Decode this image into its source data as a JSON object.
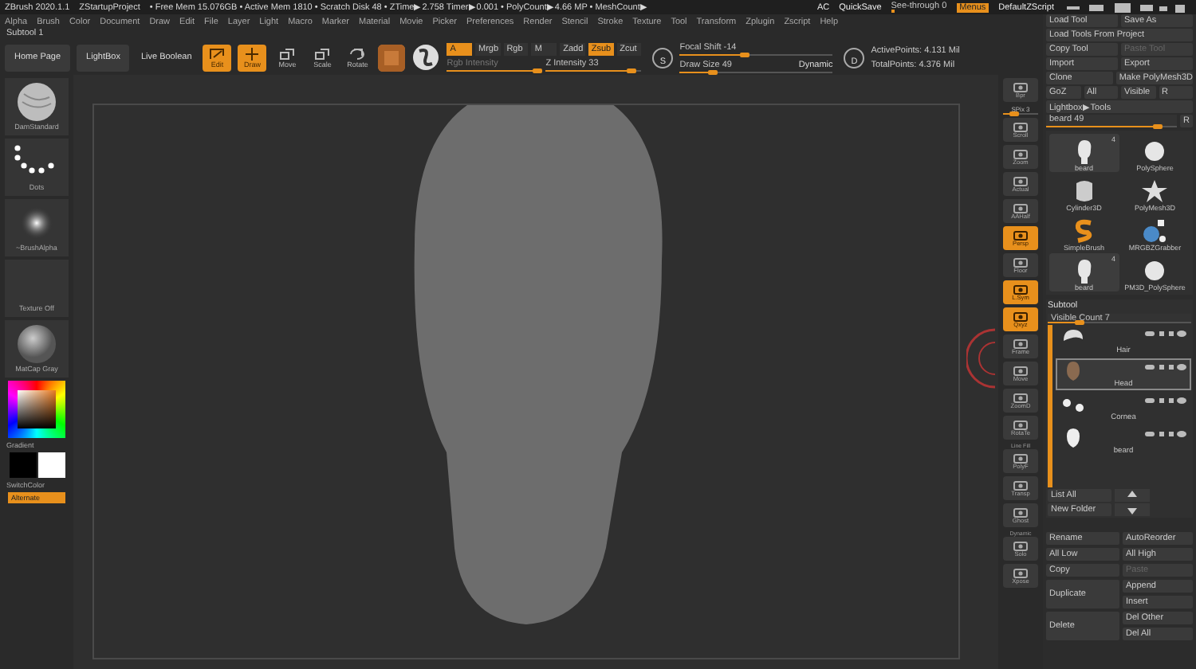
{
  "title_bar": {
    "app": "ZBrush 2020.1.1",
    "project": "ZStartupProject",
    "stats": "• Free Mem 15.076GB • Active Mem 1810 • Scratch Disk 48 • ZTime▶2.758 Timer▶0.001 • PolyCount▶4.66 MP • MeshCount▶",
    "controls": [
      {
        "kind": "text",
        "label": "AC"
      },
      {
        "kind": "text",
        "label": "QuickSave"
      },
      {
        "kind": "slider",
        "label": "See-through  0",
        "level": 0.05
      },
      {
        "kind": "toggle",
        "label": "Menus",
        "on": true
      },
      {
        "kind": "text",
        "label": "DefaultZScript"
      }
    ]
  },
  "menu_bar": [
    "Alpha",
    "Brush",
    "Color",
    "Document",
    "Draw",
    "Edit",
    "File",
    "Layer",
    "Light",
    "Macro",
    "Marker",
    "Material",
    "Movie",
    "Picker",
    "Preferences",
    "Render",
    "Stencil",
    "Stroke",
    "Texture",
    "Tool",
    "Transform",
    "Zplugin",
    "Zscript",
    "Help"
  ],
  "subtool_label": "Subtool 1",
  "toolbar": {
    "buttons": [
      {
        "kind": "plain",
        "label": "Home Page",
        "on": false
      },
      {
        "kind": "plain",
        "label": "LightBox",
        "on": false
      },
      {
        "kind": "text",
        "label": "Live Boolean",
        "on": false
      },
      {
        "kind": "edit",
        "label": "Edit",
        "on": true
      },
      {
        "kind": "draw",
        "label": "Draw",
        "on": true
      },
      {
        "kind": "move",
        "label": "Move",
        "on": false
      },
      {
        "kind": "scale",
        "label": "Scale",
        "on": false
      },
      {
        "kind": "rotate",
        "label": "Rotate",
        "on": false
      }
    ],
    "modes": [
      {
        "label": "A",
        "on": true
      },
      {
        "label": "Mrgb",
        "on": false
      },
      {
        "label": "Rgb",
        "on": false
      },
      {
        "label": "M",
        "on": false
      },
      {
        "label": "Zadd",
        "on": false
      },
      {
        "label": "Zsub",
        "on": true
      },
      {
        "label": "Zcut",
        "on": false
      }
    ],
    "rgb_intensity": {
      "label": "Rgb Intensity",
      "level": 0.95
    },
    "z_intensity": {
      "label": "Z Intensity 33",
      "level": 0.9
    },
    "focal_icon": "S",
    "focal_shift": {
      "label": "Focal Shift -14",
      "level": 0.42
    },
    "draw_size": {
      "label": "Draw Size 49",
      "level": 0.22,
      "badge": "Dynamic"
    },
    "points_icon": "D",
    "points": [
      "ActivePoints: 4.131 Mil",
      "TotalPoints: 4.376 Mil"
    ]
  },
  "left_shelf": {
    "items": [
      {
        "kind": "brush",
        "label": "DamStandard"
      },
      {
        "kind": "stroke",
        "label": "Dots"
      },
      {
        "kind": "alpha",
        "label": "~BrushAlpha"
      },
      {
        "kind": "texture",
        "label": "Texture Off"
      },
      {
        "kind": "material",
        "label": "MatCap Gray"
      }
    ],
    "gradient_label": "Gradient",
    "switch_label": "SwitchColor",
    "alternate": {
      "label": "Alternate",
      "on": true
    }
  },
  "right_shelf": [
    {
      "kind": "button",
      "label": "Bpr",
      "on": false
    },
    {
      "kind": "slider",
      "label": "SPix 3",
      "level": 0.3
    },
    {
      "kind": "button",
      "label": "Scroll",
      "on": false
    },
    {
      "kind": "button",
      "label": "Zoom",
      "on": false
    },
    {
      "kind": "button",
      "label": "Actual",
      "on": false
    },
    {
      "kind": "button",
      "label": "AAHalf",
      "on": false
    },
    {
      "kind": "button",
      "label": "Persp",
      "on": true
    },
    {
      "kind": "button",
      "label": "Floor",
      "on": false
    },
    {
      "kind": "button",
      "label": "L.Sym",
      "on": true
    },
    {
      "kind": "button",
      "label": "Qxyz",
      "on": true
    },
    {
      "kind": "button",
      "label": "Frame",
      "on": false
    },
    {
      "kind": "button",
      "label": "Move",
      "on": false
    },
    {
      "kind": "button",
      "label": "ZoomD",
      "on": false
    },
    {
      "kind": "button",
      "label": "RotaTe",
      "on": false
    },
    {
      "kind": "button",
      "label": "PolyF",
      "caption": "Line Fill",
      "on": false
    },
    {
      "kind": "button",
      "label": "Transp",
      "on": false
    },
    {
      "kind": "button",
      "label": "Ghost",
      "on": false
    },
    {
      "kind": "button",
      "label": "Solo",
      "caption": "Dynamic",
      "on": false
    },
    {
      "kind": "button",
      "label": "Xpose",
      "on": false
    }
  ],
  "tool_panel": {
    "rows": [
      [
        {
          "label": "Load Tool",
          "disabled": false
        },
        {
          "label": "Save As",
          "disabled": false
        }
      ],
      [
        {
          "label": "Load Tools From Project",
          "disabled": false
        }
      ],
      [
        {
          "label": "Copy Tool",
          "disabled": false
        },
        {
          "label": "Paste Tool",
          "disabled": true
        }
      ],
      [
        {
          "label": "Import",
          "disabled": false
        },
        {
          "label": "Export",
          "disabled": false
        }
      ],
      [
        {
          "label": "Clone",
          "disabled": false
        },
        {
          "label": "Make PolyMesh3D",
          "disabled": false
        }
      ],
      [
        {
          "label": "GoZ",
          "disabled": false
        },
        {
          "label": "All",
          "disabled": false
        },
        {
          "label": "Visible",
          "disabled": false
        },
        {
          "label": "R",
          "disabled": false
        }
      ],
      [
        {
          "label": "Lightbox▶Tools",
          "disabled": false
        }
      ]
    ],
    "slider": {
      "label": "beard  49",
      "level": 0.85,
      "reset": "R"
    },
    "tools": [
      {
        "kind": "head",
        "name": "beard",
        "count": "4"
      },
      {
        "kind": "sphere",
        "name": "PolySphere"
      },
      {
        "kind": "cylinder",
        "name": "Cylinder3D"
      },
      {
        "kind": "star",
        "name": "PolyMesh3D"
      },
      {
        "kind": "swirl",
        "name": "SimpleBrush"
      },
      {
        "kind": "grabber",
        "name": "MRGBZGrabber"
      },
      {
        "kind": "head",
        "name": "beard",
        "count": "4"
      },
      {
        "kind": "sphere",
        "name": "PM3D_PolySphere"
      }
    ]
  },
  "subtool": {
    "title": "Subtool",
    "visible_count": {
      "label": "Visible Count 7",
      "level": 0.22
    },
    "items": [
      {
        "kind": "hair",
        "name": "Hair",
        "selected": false
      },
      {
        "kind": "head",
        "name": "Head",
        "selected": true
      },
      {
        "kind": "eyes",
        "name": "Cornea",
        "selected": false
      },
      {
        "kind": "beard",
        "name": "beard",
        "selected": false
      }
    ],
    "list_buttons": [
      "List All",
      "New Folder"
    ],
    "action_rows": [
      {
        "left": {
          "label": "Rename",
          "disabled": false
        },
        "right": [
          {
            "label": "AutoReorder",
            "disabled": false
          }
        ]
      },
      {
        "left": {
          "label": "All Low",
          "disabled": false
        },
        "right": [
          {
            "label": "All High",
            "disabled": false
          }
        ]
      },
      {
        "left": {
          "label": "Copy",
          "disabled": false
        },
        "right": [
          {
            "label": "Paste",
            "disabled": true
          }
        ]
      },
      {
        "left": {
          "label": "Duplicate",
          "disabled": false
        },
        "right": [
          {
            "label": "Append",
            "disabled": false
          },
          {
            "label": "Insert",
            "disabled": false
          }
        ]
      },
      {
        "left": {
          "label": "Delete",
          "disabled": false
        },
        "right": [
          {
            "label": "Del Other",
            "disabled": false
          },
          {
            "label": "Del All",
            "disabled": false
          }
        ]
      }
    ]
  }
}
